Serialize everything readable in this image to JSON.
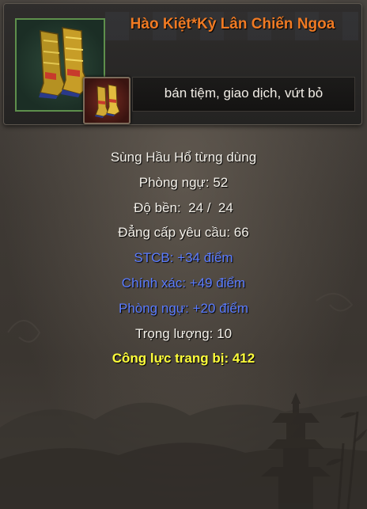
{
  "item": {
    "name": "Hào Kiệt*Kỳ Lân Chiến Ngoa",
    "actions": "bán tiệm, giao dịch, vứt bỏ"
  },
  "stats": {
    "owner": "Sùng Hầu Hổ từng dùng",
    "defense": "Phòng ngự: 52",
    "durability": "Độ bền:  24 /  24",
    "level_req": "Đẳng cấp yêu cầu: 66",
    "stcb": "STCB: +34 điểm",
    "accuracy": "Chính xác: +49 điểm",
    "defense_bonus": "Phòng ngự: +20 điểm",
    "weight": "Trọng lượng: 10",
    "power": "Công lực trang bị: 412"
  },
  "colors": {
    "name": "#f07a23",
    "normal_stat": "#f4f1ea",
    "bonus_stat": "#5b7cff",
    "power_stat": "#ffff3a"
  },
  "icons": {
    "portrait": "golden-boots-icon",
    "small": "boots-thumbnail-icon"
  }
}
